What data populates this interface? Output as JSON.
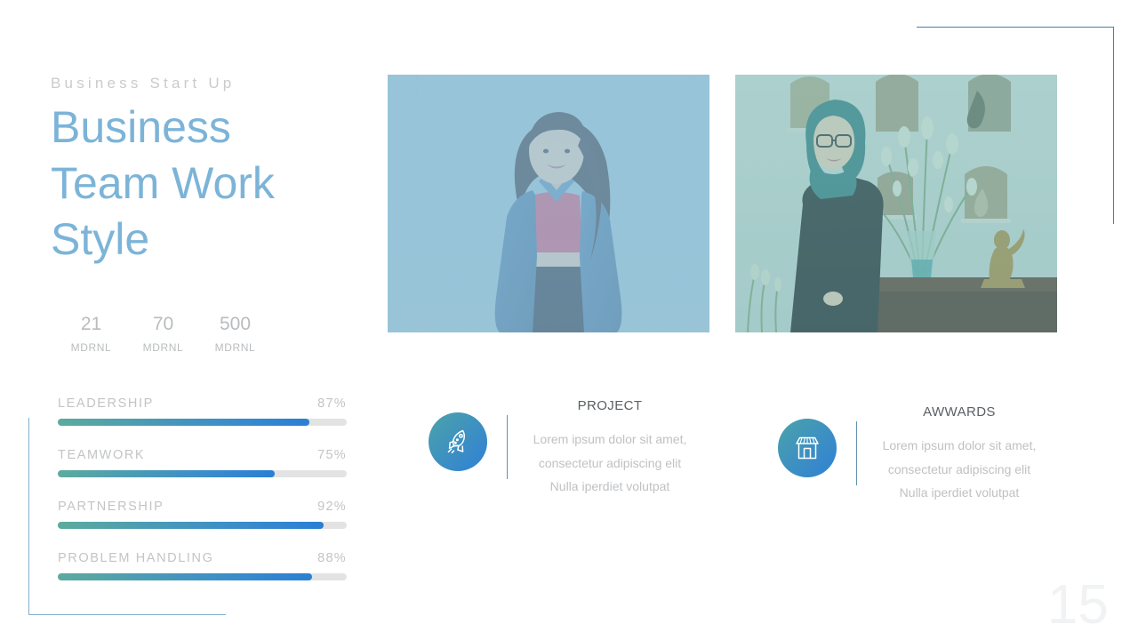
{
  "slide": {
    "eyebrow": "Business Start Up",
    "headline": "Business Team Work Style",
    "page_number": "15"
  },
  "stats": [
    {
      "value": "21",
      "label": "MDRNL"
    },
    {
      "value": "70",
      "label": "MDRNL"
    },
    {
      "value": "500",
      "label": "MDRNL"
    }
  ],
  "skills": [
    {
      "name": "LEADERSHIP",
      "percent_label": "87%",
      "percent": 87
    },
    {
      "name": "TEAMWORK",
      "percent_label": "75%",
      "percent": 75
    },
    {
      "name": "PARTNERSHIP",
      "percent_label": "92%",
      "percent": 92
    },
    {
      "name": "PROBLEM HANDLING",
      "percent_label": "88%",
      "percent": 88
    }
  ],
  "photos": [
    {
      "name": "photo-woman-denim-jacket",
      "alt": "Smiling woman in denim jacket and pink crop top against a wall"
    },
    {
      "name": "photo-woman-hijab-interior",
      "alt": "Woman in teal hijab and black dress beside a vase of white flowers"
    }
  ],
  "features": [
    {
      "icon": "rocket-icon",
      "title": "PROJECT",
      "body": "Lorem ipsum dolor sit amet, consectetur adipiscing elit Nulla iperdiet volutpat"
    },
    {
      "icon": "shop-icon",
      "title": "AWWARDS",
      "body": "Lorem ipsum dolor sit amet, consectetur adipiscing elit Nulla iperdiet volutpat"
    }
  ],
  "colors": {
    "headline": "#7cb4d8",
    "bar_start": "#5cab9e",
    "bar_end": "#2a7fd4",
    "bar_track": "#e3e3e3",
    "corner_line": "#4a7fa5",
    "muted_text": "#c2c4c6"
  }
}
